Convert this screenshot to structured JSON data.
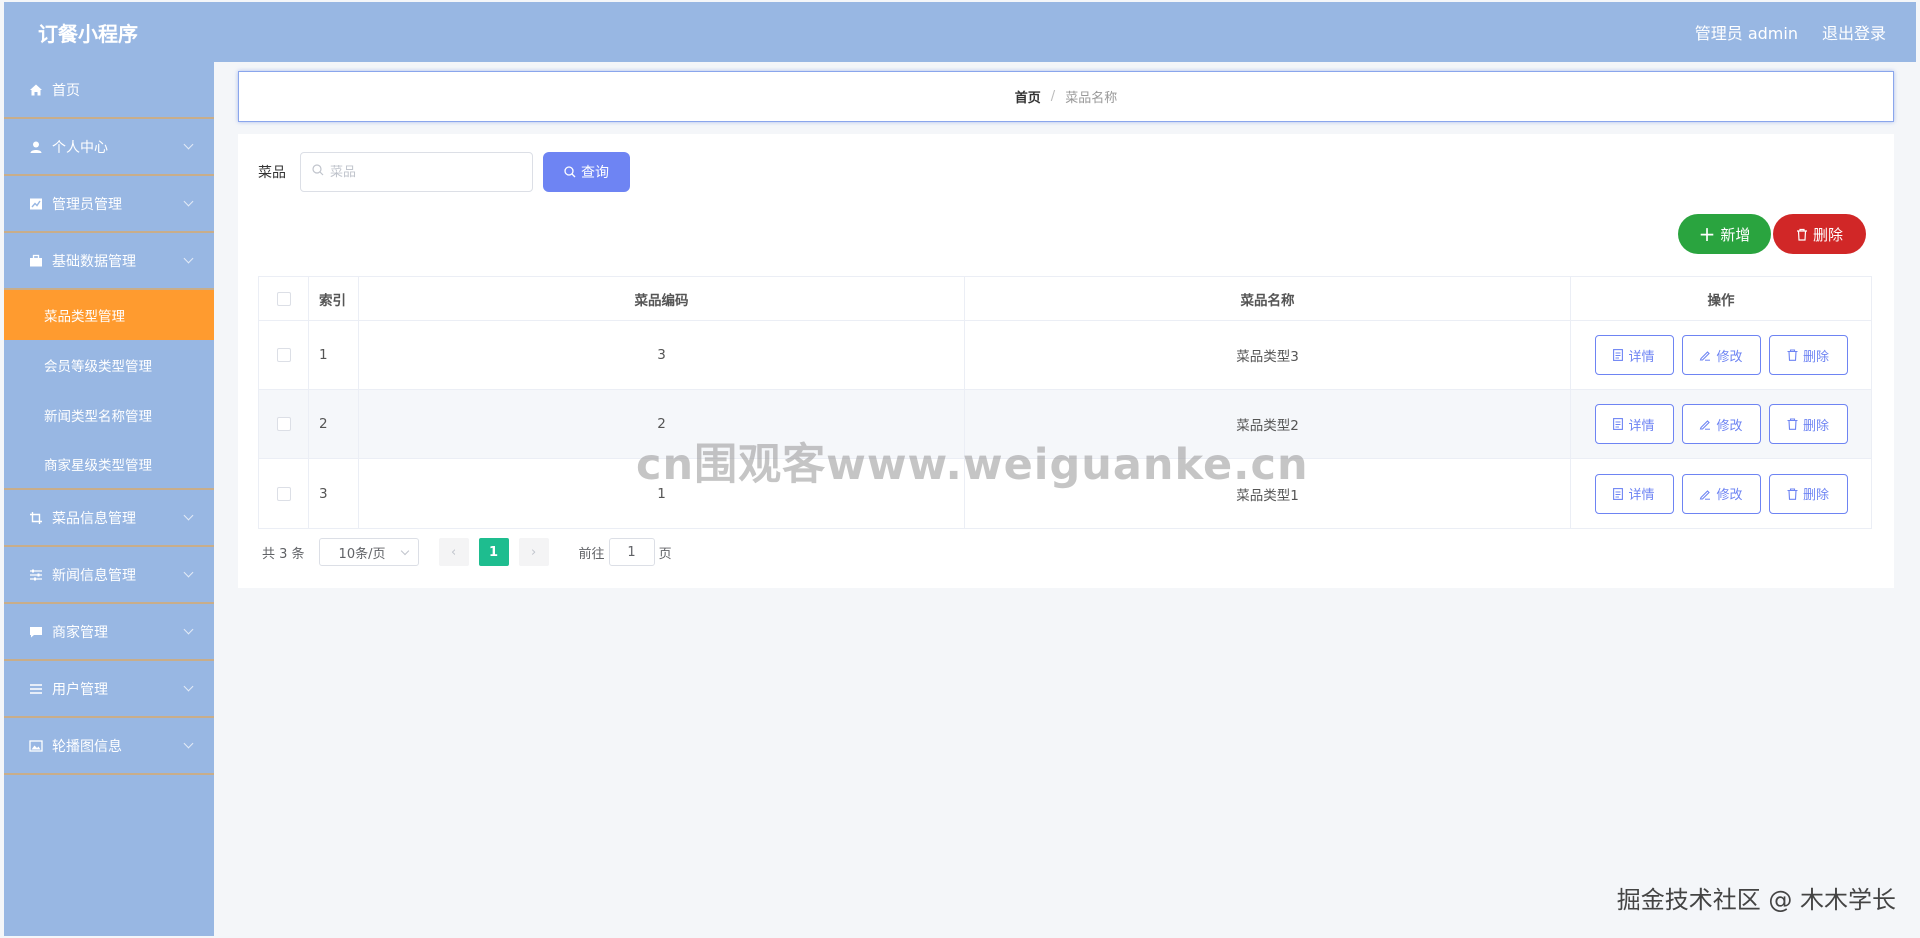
{
  "app_title": "订餐小程序",
  "header": {
    "admin_label": "管理员 admin",
    "logout_label": "退出登录"
  },
  "sidebar": {
    "items": [
      {
        "label": "首页",
        "icon": "home-icon"
      },
      {
        "label": "个人中心",
        "icon": "user-icon"
      },
      {
        "label": "管理员管理",
        "icon": "chart-icon"
      },
      {
        "label": "基础数据管理",
        "icon": "briefcase-icon"
      },
      {
        "label": "菜品信息管理",
        "icon": "crop-icon"
      },
      {
        "label": "新闻信息管理",
        "icon": "sliders-icon"
      },
      {
        "label": "商家管理",
        "icon": "message-icon"
      },
      {
        "label": "用户管理",
        "icon": "list-icon"
      },
      {
        "label": "轮播图信息",
        "icon": "image-icon"
      }
    ],
    "subitems": [
      {
        "label": "菜品类型管理",
        "active": true
      },
      {
        "label": "会员等级类型管理",
        "active": false
      },
      {
        "label": "新闻类型名称管理",
        "active": false
      },
      {
        "label": "商家星级类型管理",
        "active": false
      }
    ]
  },
  "breadcrumb": {
    "home": "首页",
    "current": "菜品名称"
  },
  "search": {
    "label": "菜品",
    "placeholder": "菜品",
    "button": "查询"
  },
  "actions": {
    "add": "新增",
    "delete": "删除"
  },
  "table": {
    "columns": [
      "索引",
      "菜品编码",
      "菜品名称",
      "操作"
    ],
    "rows": [
      {
        "index": "1",
        "code": "3",
        "name": "菜品类型3"
      },
      {
        "index": "2",
        "code": "2",
        "name": "菜品类型2"
      },
      {
        "index": "3",
        "code": "1",
        "name": "菜品类型1"
      }
    ],
    "row_actions": {
      "detail": "详情",
      "edit": "修改",
      "delete": "删除"
    }
  },
  "pagination": {
    "total": "共 3 条",
    "page_size": "10条/页",
    "current_page": "1",
    "goto_prefix": "前往",
    "goto_value": "1",
    "goto_suffix": "页"
  },
  "watermark": "cn围观客www.weiguanke.cn",
  "credit": "掘金技术社区 @ 木木学长",
  "colors": {
    "topbar": "#98b7e3",
    "active_menu": "#ff9b2f",
    "primary": "#6e84f3",
    "success": "#2aa43f",
    "danger": "#d12727",
    "page_active": "#1ebd8f"
  }
}
